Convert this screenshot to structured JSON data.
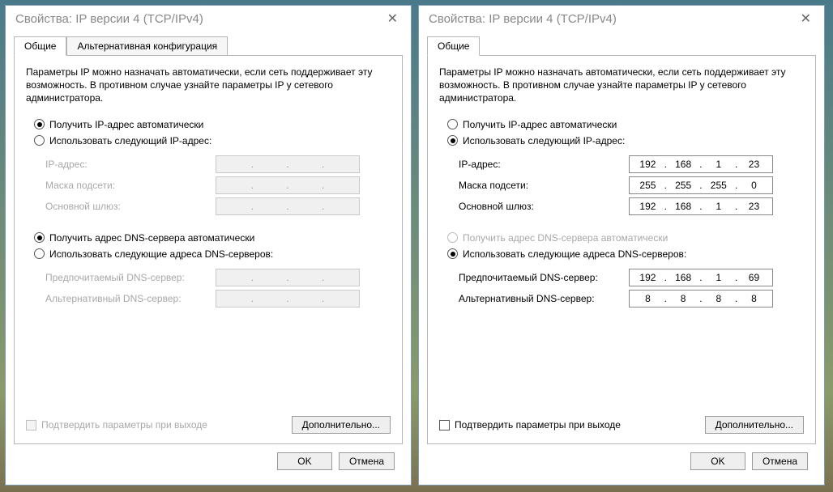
{
  "left": {
    "title": "Свойства: IP версии 4 (TCP/IPv4)",
    "tabs": {
      "general": "Общие",
      "alt": "Альтернативная конфигурация"
    },
    "desc": "Параметры IP можно назначать автоматически, если сеть поддерживает эту возможность. В противном случае узнайте параметры IP у сетевого администратора.",
    "radios": {
      "autoIp": "Получить IP-адрес автоматически",
      "manualIp": "Использовать следующий IP-адрес:",
      "autoDns": "Получить адрес DNS-сервера автоматически",
      "manualDns": "Использовать следующие адреса DNS-серверов:"
    },
    "labels": {
      "ip": "IP-адрес:",
      "mask": "Маска подсети:",
      "gateway": "Основной шлюз:",
      "dns1": "Предпочитаемый DNS-сервер:",
      "dns2": "Альтернативный DNS-сервер:"
    },
    "fields": {
      "ip": [
        "",
        "",
        "",
        ""
      ],
      "mask": [
        "",
        "",
        "",
        ""
      ],
      "gateway": [
        "",
        "",
        "",
        ""
      ],
      "dns1": [
        "",
        "",
        "",
        ""
      ],
      "dns2": [
        "",
        "",
        "",
        ""
      ]
    },
    "validate": "Подтвердить параметры при выходе",
    "advanced": "Дополнительно...",
    "ok": "OK",
    "cancel": "Отмена"
  },
  "right": {
    "title": "Свойства: IP версии 4 (TCP/IPv4)",
    "tabs": {
      "general": "Общие"
    },
    "desc": "Параметры IP можно назначать автоматически, если сеть поддерживает эту возможность. В противном случае узнайте параметры IP у сетевого администратора.",
    "radios": {
      "autoIp": "Получить IP-адрес автоматически",
      "manualIp": "Использовать следующий IP-адрес:",
      "autoDns": "Получить адрес DNS-сервера автоматически",
      "manualDns": "Использовать следующие адреса DNS-серверов:"
    },
    "labels": {
      "ip": "IP-адрес:",
      "mask": "Маска подсети:",
      "gateway": "Основной шлюз:",
      "dns1": "Предпочитаемый DNS-сервер:",
      "dns2": "Альтернативный DNS-сервер:"
    },
    "fields": {
      "ip": [
        "192",
        "168",
        "1",
        "23"
      ],
      "mask": [
        "255",
        "255",
        "255",
        "0"
      ],
      "gateway": [
        "192",
        "168",
        "1",
        "23"
      ],
      "dns1": [
        "192",
        "168",
        "1",
        "69"
      ],
      "dns2": [
        "8",
        "8",
        "8",
        "8"
      ]
    },
    "validate": "Подтвердить параметры при выходе",
    "advanced": "Дополнительно...",
    "ok": "OK",
    "cancel": "Отмена"
  }
}
